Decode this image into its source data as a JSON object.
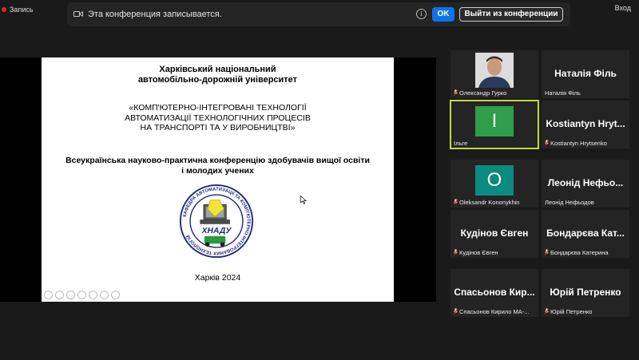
{
  "recording": {
    "label": "Запись",
    "view": "Вход"
  },
  "notice": {
    "text": "Эта конференция записывается.",
    "info": "i",
    "ok": "OK",
    "leave": "Выйти из конференции"
  },
  "slide": {
    "university": "Харківський національний\nавтомобільно-дорожній університет",
    "conference": "«КОМП'ЮТЕРНО-ІНТЕГРОВАНІ ТЕХНОЛОГІЇ\nАВТОМАТИЗАЦІЇ ТЕХНОЛОГІЧНИХ ПРОЦЕСІВ\nНА ТРАНСПОРТІ ТА У ВИРОБНИЦТВІ»",
    "description": "Всеукраїнська науково-практична конференцію здобувачів вищої освіти\nі молодих учених",
    "city_year": "Харків 2024",
    "logo_ring_text": "КАФЕДРА АВТОМАТИЗАЦІЇ ТА КОМП'ЮТЕРНО-ІНТЕГРОВАНИХ ТЕХНОЛОГІЙ",
    "logo_word": "ХНАДУ"
  },
  "participants": [
    {
      "display": "",
      "caption": "Олександр Гурко",
      "avatar": "photo",
      "muted": true
    },
    {
      "display": "Наталія Філь",
      "caption": "Наталія Філь",
      "muted": false
    },
    {
      "display": "I",
      "caption": "Ільге",
      "avatar": "letter",
      "avatar_color": "#2f9d4a",
      "muted": false,
      "active": true
    },
    {
      "display": "Kostiantyn Hryt...",
      "caption": "Kostiantyn Hrytsenko",
      "muted": true
    },
    {
      "display": "O",
      "caption": "Oleksandr Kononykhin",
      "avatar": "letter",
      "avatar_color": "#0b8a80",
      "muted": true
    },
    {
      "display": "Леонід Нефьо...",
      "caption": "Леонід Нефьодов",
      "muted": false
    },
    {
      "display": "Кудінов Євген",
      "caption": "Кудінов Євген",
      "muted": true
    },
    {
      "display": "Бондарєва Кат...",
      "caption": "Бондарєва Катерина",
      "muted": true
    },
    {
      "display": "Спасьонов Кир...",
      "caption": "Спасьонов Кирило МА-...",
      "muted": true
    },
    {
      "display": "Юрій Петренко",
      "caption": "Юрій Петренко",
      "muted": true
    }
  ],
  "colors": {
    "accent": "#0e72ed",
    "active_speaker": "#c4d93c",
    "muted_icon": "#e02828"
  }
}
